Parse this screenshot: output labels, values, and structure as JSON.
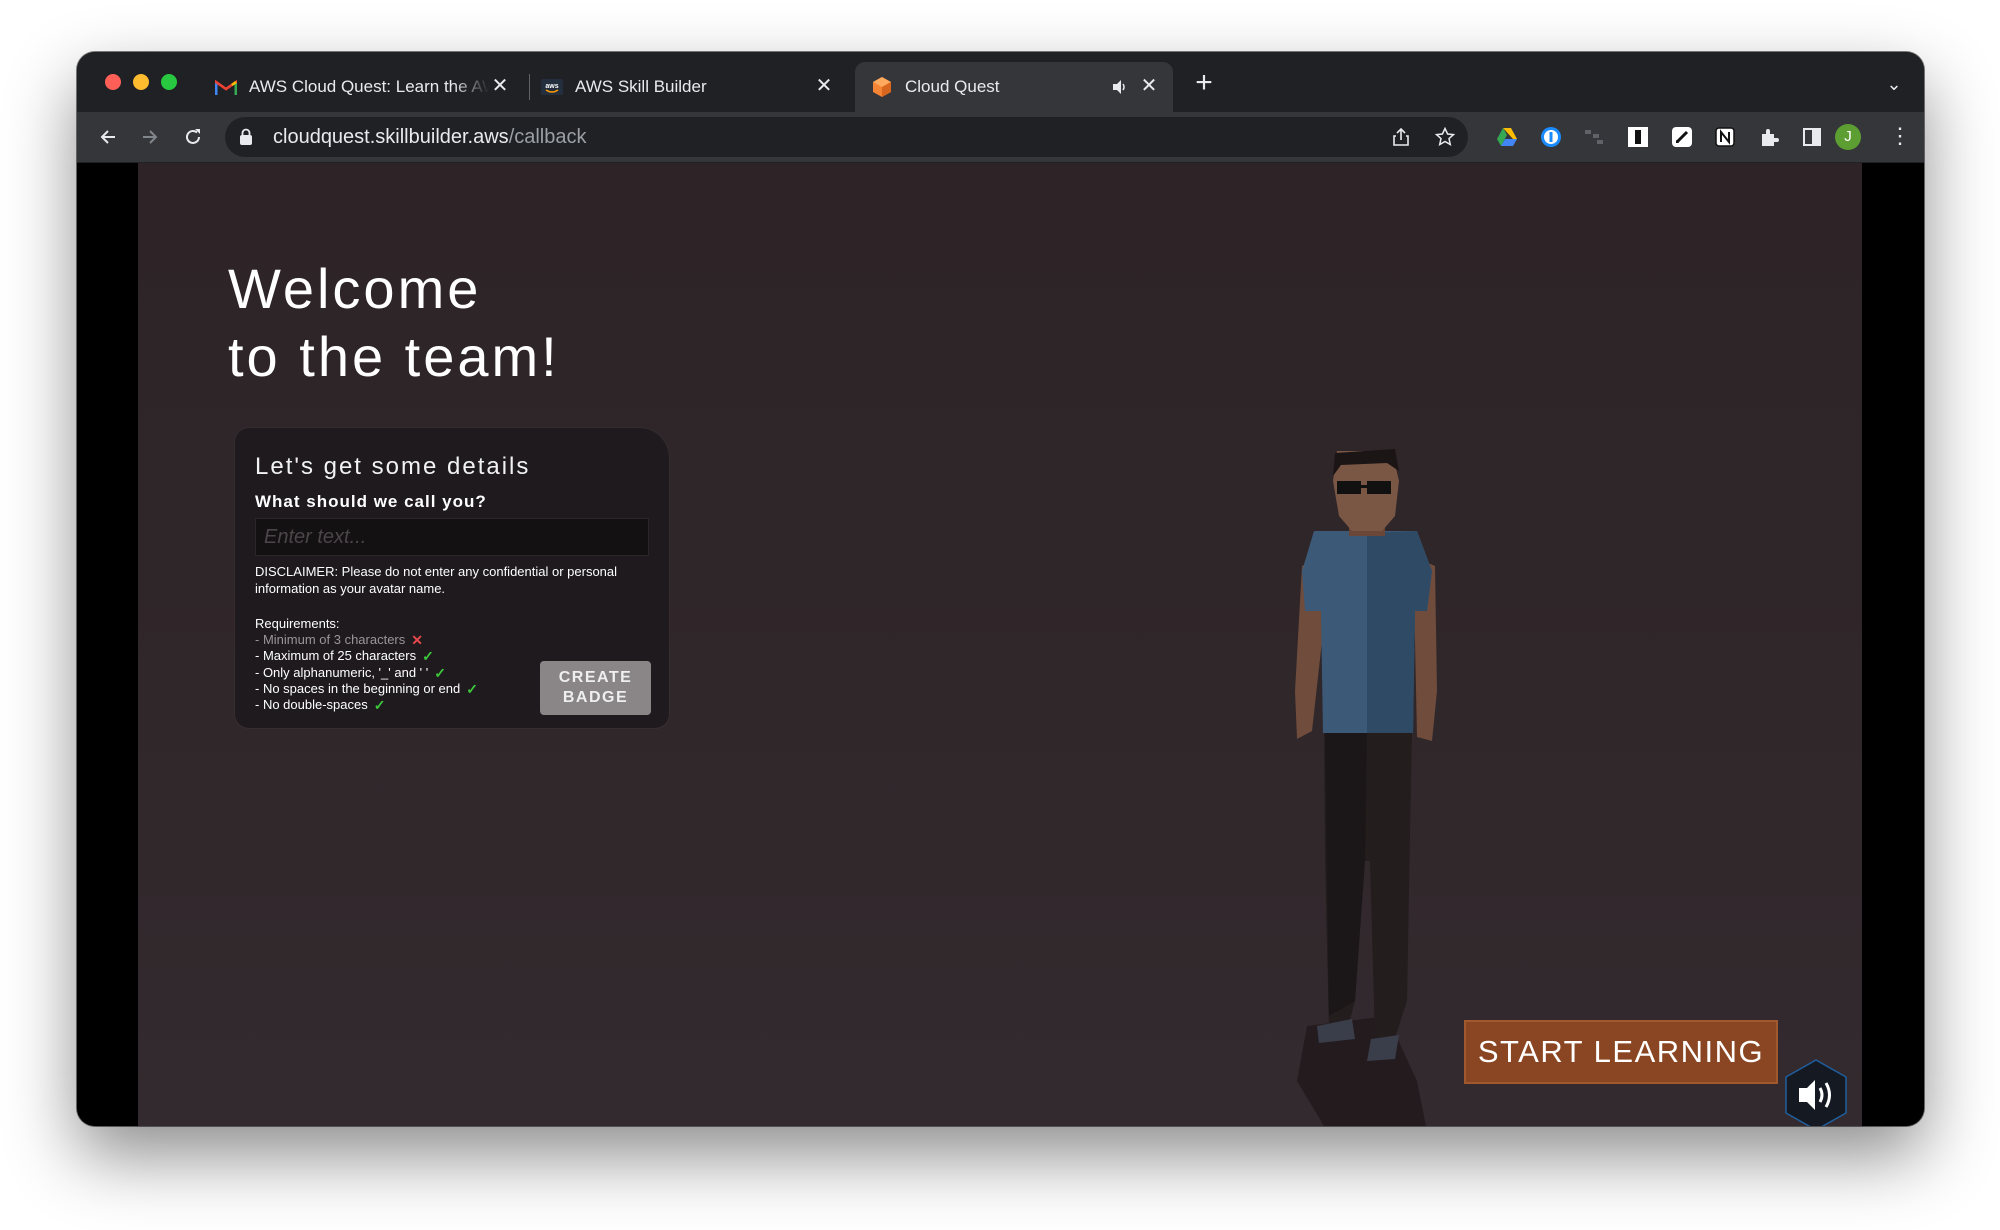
{
  "browser": {
    "tabs": [
      {
        "title": "AWS Cloud Quest: Learn the AWS",
        "icon": "gmail-icon",
        "active": false
      },
      {
        "title": "AWS Skill Builder",
        "icon": "aws-icon",
        "active": false
      },
      {
        "title": "Cloud Quest",
        "icon": "cube-icon",
        "active": true,
        "audio": true
      }
    ],
    "url": {
      "host": "cloudquest.skillbuilder.aws",
      "path": "/callback"
    },
    "profile_initial": "J",
    "extensions": [
      "google-drive-icon",
      "1password-icon",
      "puzzle-grid-icon",
      "instapaper-icon",
      "notes-icon",
      "notion-icon",
      "extensions-icon",
      "sidebar-icon"
    ]
  },
  "game": {
    "welcome_line1": "Welcome",
    "welcome_line2": "to the team!",
    "form": {
      "title": "Let's get some details",
      "question": "What should we call you?",
      "input_placeholder": "Enter text...",
      "input_value": "",
      "disclaimer": "DISCLAIMER: Please do not enter any confidential or personal information as your avatar name.",
      "requirements_title": "Requirements:",
      "requirements": [
        {
          "text": "- Minimum of 3 characters",
          "met": false
        },
        {
          "text": "- Maximum of 25 characters",
          "met": true
        },
        {
          "text": "- Only alphanumeric, '_' and ' '",
          "met": true
        },
        {
          "text": "- No spaces in the beginning or end",
          "met": true
        },
        {
          "text": "- No double-spaces",
          "met": true
        }
      ],
      "create_button_line1": "CREATE",
      "create_button_line2": "BADGE"
    },
    "start_button": "START LEARNING",
    "colors": {
      "background": "#2f2629",
      "panel": "#1e1a1d",
      "start_button": "#8a4622",
      "fail": "#e5484d",
      "pass": "#3cc83c"
    }
  }
}
